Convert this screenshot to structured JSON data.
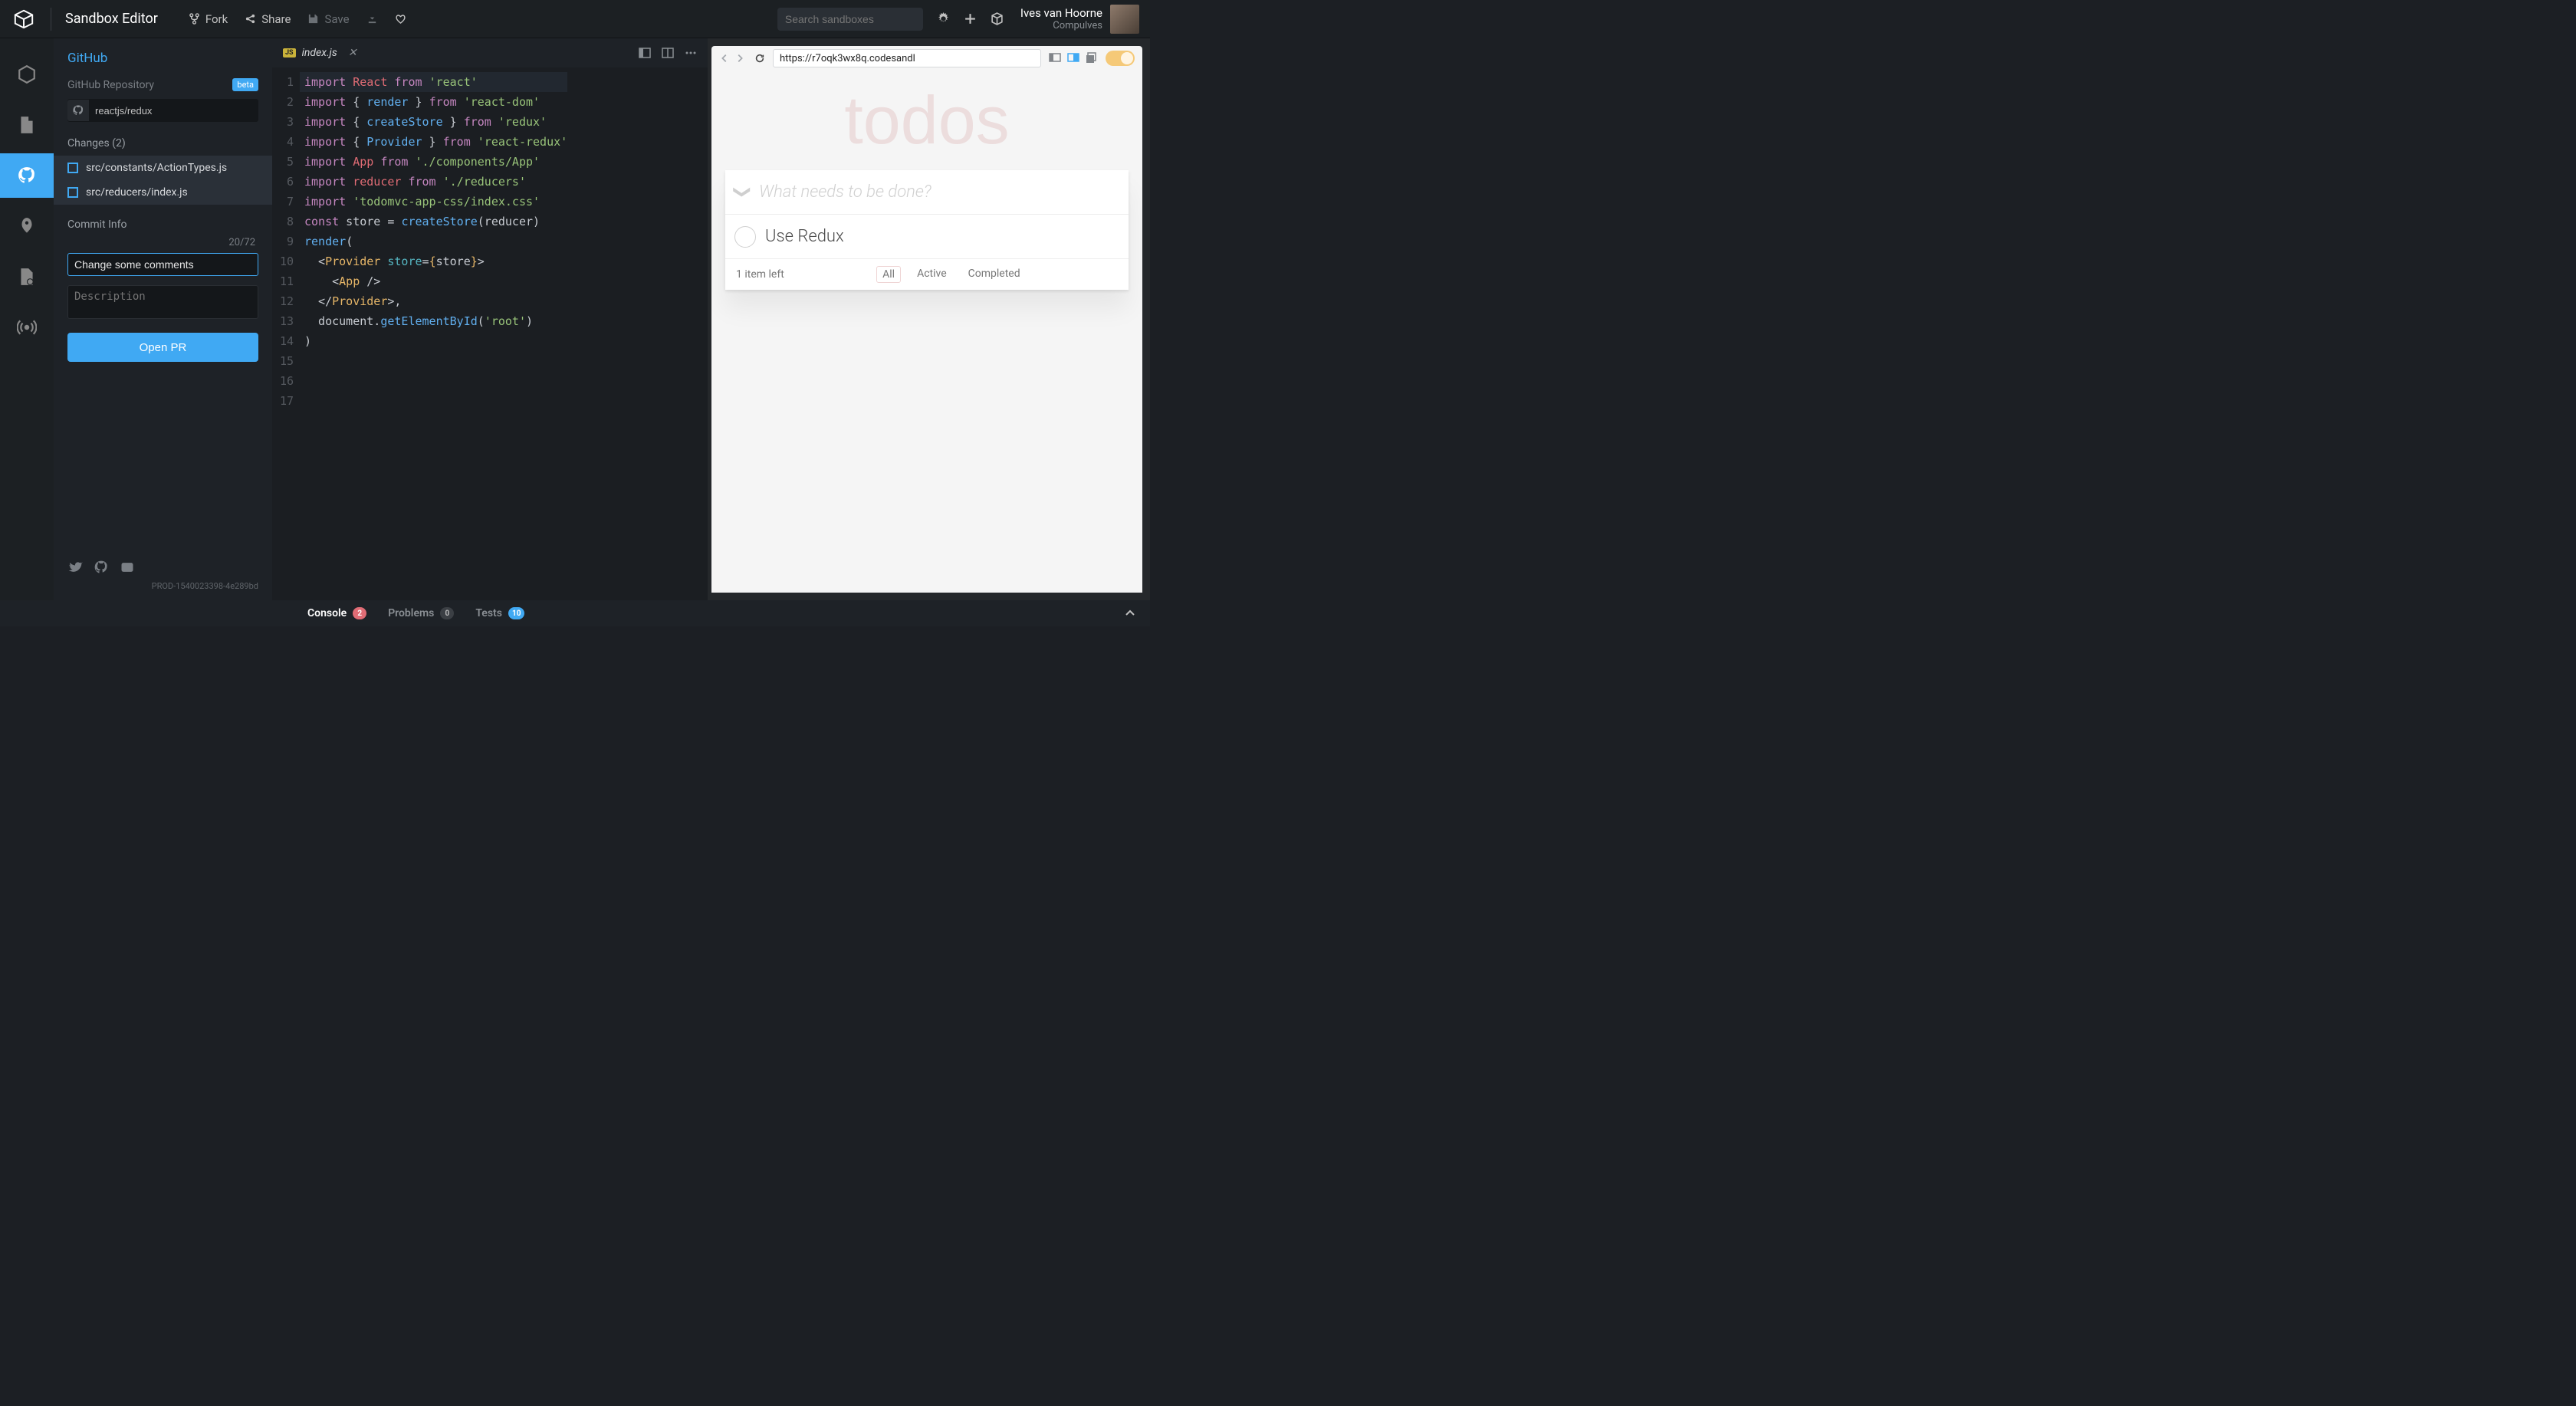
{
  "app_title": "Sandbox Editor",
  "top_actions": {
    "fork": "Fork",
    "share": "Share",
    "save": "Save"
  },
  "search_placeholder": "Search sandboxes",
  "user": {
    "name": "Ives van Hoorne",
    "sub": "Compulves"
  },
  "sidebar": {
    "title": "GitHub",
    "repo_label": "GitHub Repository",
    "beta": "beta",
    "repo_value": "reactjs/redux",
    "changes_title": "Changes (2)",
    "files": [
      "src/constants/ActionTypes.js",
      "src/reducers/index.js"
    ],
    "commit_info": "Commit Info",
    "counter": "20/72",
    "commit_message": "Change some comments",
    "description_placeholder": "Description",
    "open_pr": "Open PR",
    "build": "PROD-1540023398-4e289bd"
  },
  "tab": {
    "filename": "index.js",
    "badge": "JS"
  },
  "code": {
    "lines": [
      [
        [
          "k-purple",
          "import"
        ],
        [
          "",
          " "
        ],
        [
          "k-red",
          "React"
        ],
        [
          "",
          " "
        ],
        [
          "k-purple",
          "from"
        ],
        [
          "",
          " "
        ],
        [
          "k-string",
          "'react'"
        ]
      ],
      [
        [
          "k-purple",
          "import"
        ],
        [
          "",
          " { "
        ],
        [
          "k-blue",
          "render"
        ],
        [
          "",
          " } "
        ],
        [
          "k-purple",
          "from"
        ],
        [
          "",
          " "
        ],
        [
          "k-string",
          "'react-dom'"
        ]
      ],
      [
        [
          "k-purple",
          "import"
        ],
        [
          "",
          " { "
        ],
        [
          "k-blue",
          "createStore"
        ],
        [
          "",
          " } "
        ],
        [
          "k-purple",
          "from"
        ],
        [
          "",
          " "
        ],
        [
          "k-string",
          "'redux'"
        ]
      ],
      [
        [
          "k-purple",
          "import"
        ],
        [
          "",
          " { "
        ],
        [
          "k-blue",
          "Provider"
        ],
        [
          "",
          " } "
        ],
        [
          "k-purple",
          "from"
        ],
        [
          "",
          " "
        ],
        [
          "k-string",
          "'react-redux'"
        ]
      ],
      [
        [
          "k-purple",
          "import"
        ],
        [
          "",
          " "
        ],
        [
          "k-red",
          "App"
        ],
        [
          "",
          " "
        ],
        [
          "k-purple",
          "from"
        ],
        [
          "",
          " "
        ],
        [
          "k-string",
          "'./components/App'"
        ]
      ],
      [
        [
          "k-purple",
          "import"
        ],
        [
          "",
          " "
        ],
        [
          "k-red",
          "reducer"
        ],
        [
          "",
          " "
        ],
        [
          "k-purple",
          "from"
        ],
        [
          "",
          " "
        ],
        [
          "k-string",
          "'./reducers'"
        ]
      ],
      [
        [
          "k-purple",
          "import"
        ],
        [
          "",
          " "
        ],
        [
          "k-string",
          "'todomvc-app-css/index.css'"
        ]
      ],
      [
        [
          "",
          ""
        ]
      ],
      [
        [
          "k-purple",
          "const"
        ],
        [
          "",
          " store = "
        ],
        [
          "k-blue",
          "createStore"
        ],
        [
          "",
          "(reducer)"
        ]
      ],
      [
        [
          "",
          ""
        ]
      ],
      [
        [
          "k-blue",
          "render"
        ],
        [
          "",
          "("
        ]
      ],
      [
        [
          "",
          "  <"
        ],
        [
          "k-orange",
          "Provider"
        ],
        [
          "",
          " "
        ],
        [
          "k-teal",
          "store"
        ],
        [
          "",
          "="
        ],
        [
          "k-orange",
          "{"
        ],
        [
          "",
          "store"
        ],
        [
          "k-orange",
          "}"
        ],
        [
          "",
          ">"
        ]
      ],
      [
        [
          "",
          "    <"
        ],
        [
          "k-orange",
          "App"
        ],
        [
          "",
          " />"
        ]
      ],
      [
        [
          "",
          "  </"
        ],
        [
          "k-orange",
          "Provider"
        ],
        [
          "",
          ">,"
        ]
      ],
      [
        [
          "",
          "  document."
        ],
        [
          "k-blue",
          "getElementById"
        ],
        [
          "",
          "("
        ],
        [
          "k-string",
          "'root'"
        ],
        [
          "",
          ")"
        ]
      ],
      [
        [
          "",
          ")"
        ]
      ],
      [
        [
          "",
          ""
        ]
      ]
    ]
  },
  "preview": {
    "url": "https://r7oqk3wx8q.codesandl",
    "todo": {
      "title": "todos",
      "placeholder": "What needs to be done?",
      "item": "Use Redux",
      "items_left": "1 item left",
      "filters": [
        "All",
        "Active",
        "Completed"
      ]
    }
  },
  "bottom": {
    "console": "Console",
    "console_badge": "2",
    "problems": "Problems",
    "problems_badge": "0",
    "tests": "Tests",
    "tests_badge": "10"
  }
}
